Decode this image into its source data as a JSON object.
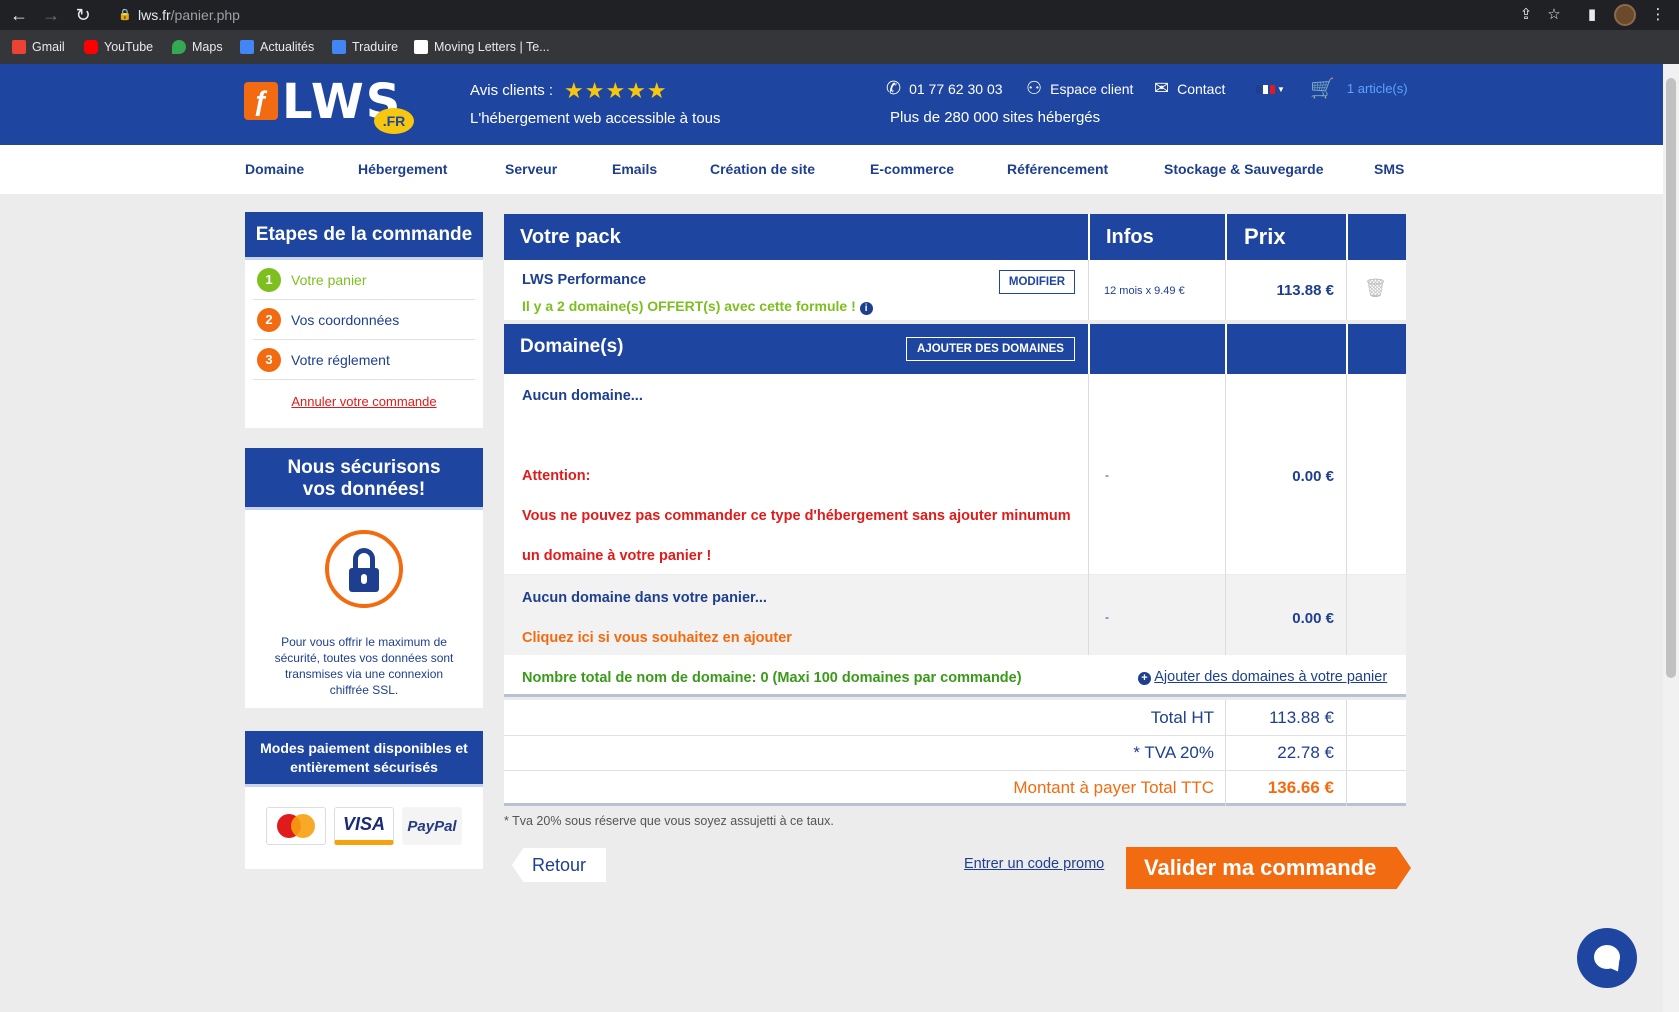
{
  "browser": {
    "url_host": "lws.fr",
    "url_path": "/panier.php",
    "bookmarks": [
      {
        "label": "Gmail",
        "icon": "gmail-icon",
        "color": "#ea4335"
      },
      {
        "label": "YouTube",
        "icon": "youtube-icon",
        "color": "#ff0000"
      },
      {
        "label": "Maps",
        "icon": "maps-icon",
        "color": "#34a853"
      },
      {
        "label": "Actualités",
        "icon": "news-icon",
        "color": "#4285f4"
      },
      {
        "label": "Traduire",
        "icon": "translate-icon",
        "color": "#4285f4"
      },
      {
        "label": "Moving Letters | Te...",
        "icon": "moving-letters-icon",
        "color": "#ffffff"
      }
    ]
  },
  "header": {
    "logo_text": "LWS",
    "logo_fr": ".FR",
    "avis_label": "Avis clients :",
    "rating_stars": 5,
    "tagline": "L'hébergement web accessible à tous",
    "phone": "01 77 62 30 03",
    "espace_client": "Espace client",
    "contact": "Contact",
    "cart_label": "1 article(s)",
    "sites_text": "Plus de 280 000 sites hébergés"
  },
  "nav": [
    "Domaine",
    "Hébergement",
    "Serveur",
    "Emails",
    "Création de site",
    "E-commerce",
    "Référencement",
    "Stockage & Sauvegarde",
    "SMS"
  ],
  "sidebar": {
    "steps_title": "Etapes de la commande",
    "steps": [
      {
        "num": "1",
        "label": "Votre panier",
        "color": "#7cbf1e"
      },
      {
        "num": "2",
        "label": "Vos coordonnées",
        "color": "#f26b10"
      },
      {
        "num": "3",
        "label": "Votre réglement",
        "color": "#f26b10"
      }
    ],
    "cancel_link": "Annuler votre commande",
    "secure_title_1": "Nous sécurisons",
    "secure_title_2": "vos données!",
    "secure_text": "Pour vous offrir le maximum de sécurité, toutes vos données sont transmises via une connexion chiffrée SSL.",
    "payment_title": "Modes paiement disponibles et entièrement sécurisés",
    "payment_methods": [
      "MasterCard",
      "VISA",
      "PayPal"
    ]
  },
  "cart": {
    "headers": {
      "pack": "Votre pack",
      "infos": "Infos",
      "prix": "Prix"
    },
    "pack": {
      "name": "LWS Performance",
      "modify_btn": "MODIFIER",
      "offer": "Il y a 2 domaine(s) OFFERT(s) avec cette formule !",
      "infos": "12 mois x 9.49 €",
      "price": "113.88 €"
    },
    "domains": {
      "header": "Domaine(s)",
      "add_btn": "AJOUTER DES DOMAINES",
      "none_text": "Aucun domaine...",
      "attention": "Attention:",
      "warning_1": "Vous ne pouvez pas commander ce type d'hébergement sans ajouter minumum",
      "warning_2": "un domaine à votre panier !",
      "infos_1": "-",
      "price_1": "0.00 €",
      "none_cart": "Aucun domaine dans votre panier...",
      "click_add": "Cliquez ici si vous souhaitez en ajouter",
      "infos_2": "-",
      "price_2": "0.00 €",
      "total_count": "Nombre total de nom de domaine: 0 (Maxi 100 domaines par commande)",
      "add_link": "Ajouter des domaines à votre panier"
    },
    "totals": {
      "ht_label": "Total HT",
      "ht_value": "113.88 €",
      "tva_label": "* TVA 20%",
      "tva_value": "22.78 €",
      "ttc_label": "Montant à payer Total TTC",
      "ttc_value": "136.66 €"
    },
    "tva_note": "* Tva 20% sous réserve que vous soyez assujetti à ce taux.",
    "back_btn": "Retour",
    "promo_link": "Entrer un code promo",
    "validate_btn": "Valider ma commande"
  },
  "colors": {
    "brand_blue": "#1e45a0",
    "accent_orange": "#f26b10",
    "success_green": "#3a9a1a",
    "error_red": "#e01b1b"
  }
}
